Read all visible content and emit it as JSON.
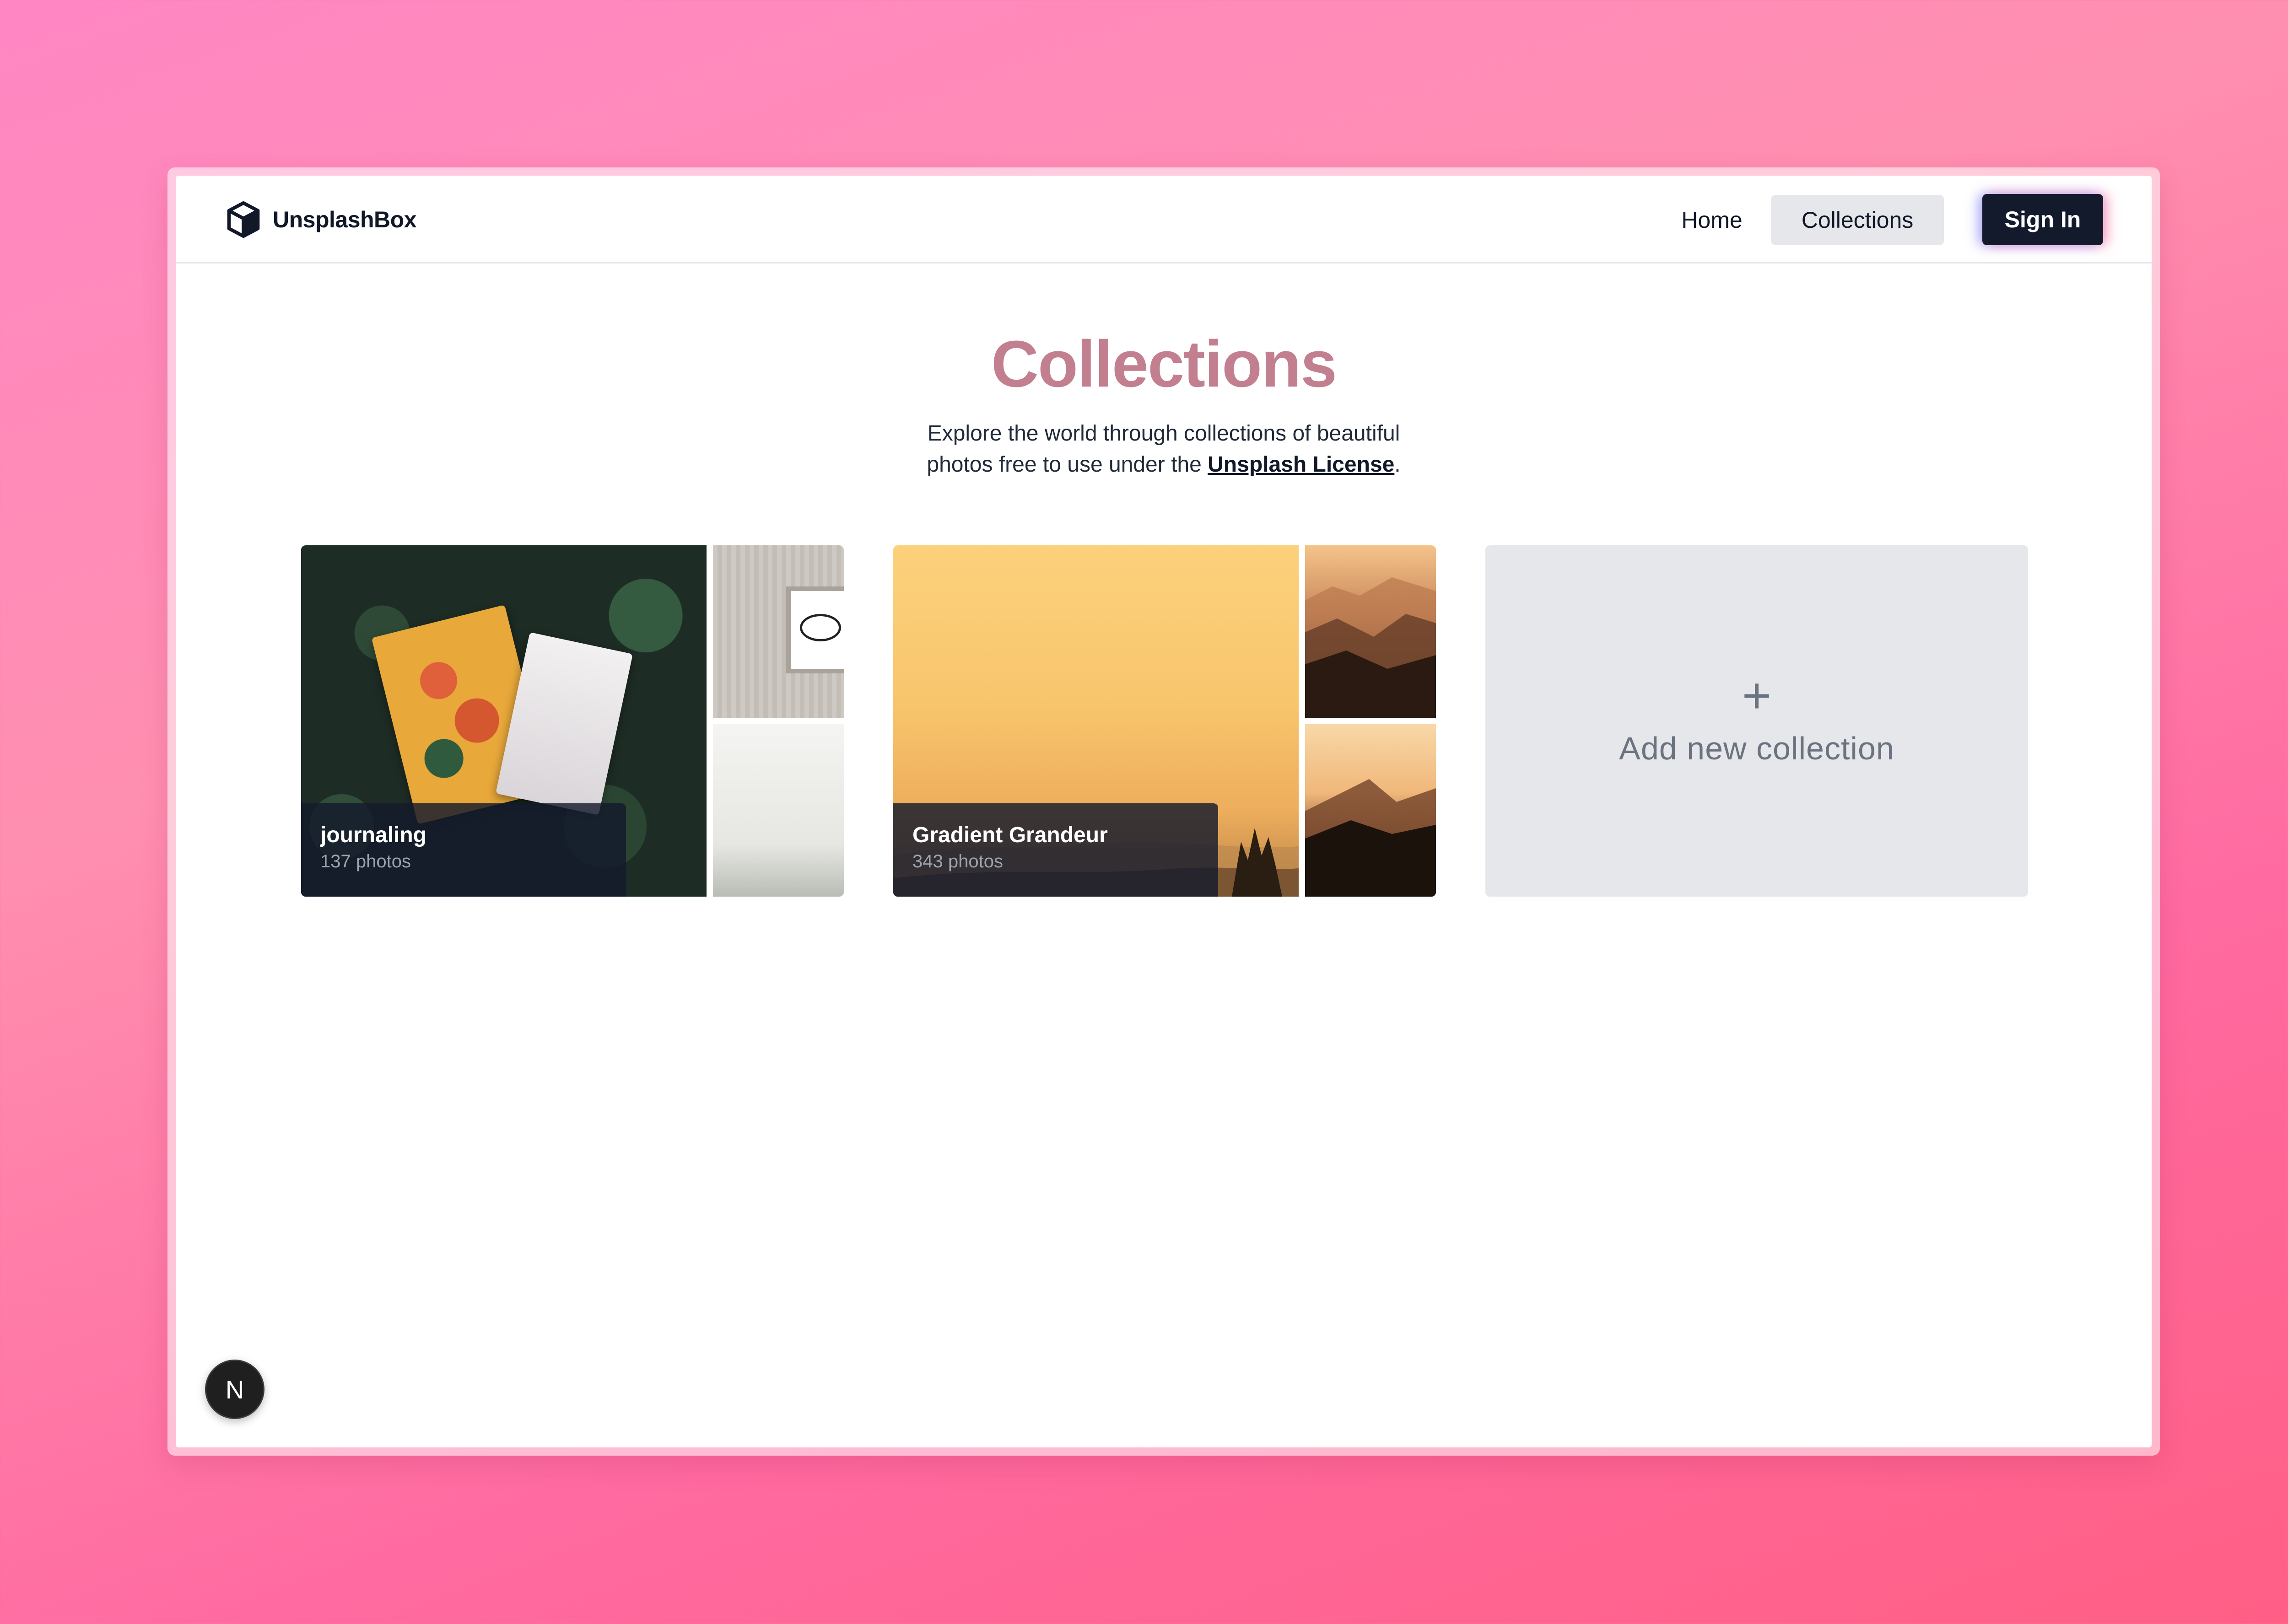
{
  "brand": {
    "name": "UnsplashBox",
    "icon": "cube-icon"
  },
  "nav": {
    "home": "Home",
    "collections": "Collections",
    "sign_in": "Sign In"
  },
  "header": {
    "title": "Collections",
    "subtitle_line1": "Explore the world through collections of beautiful",
    "subtitle_line2_prefix": "photos free to use under the",
    "license_link": "Unsplash License",
    "subtitle_suffix": "."
  },
  "collections": [
    {
      "title": "journaling",
      "count": "137 photos"
    },
    {
      "title": "Gradient Grandeur",
      "count": "343 photos"
    }
  ],
  "add_collection": {
    "icon": "plus-icon",
    "plus": "+",
    "label": "Add new collection"
  },
  "badge": {
    "label": "N",
    "icon": "nextjs-icon"
  },
  "colors": {
    "title": "#c27f8f",
    "primary_button": "#131a2c",
    "active_nav_bg": "#e5e7eb",
    "add_card_bg": "#e5e7eb"
  }
}
